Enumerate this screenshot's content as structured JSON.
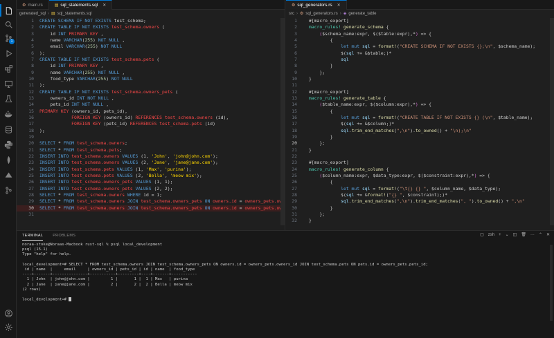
{
  "left_editor": {
    "tabs": [
      {
        "label": "main.rs",
        "active": false
      },
      {
        "label": "sql_statements.sql",
        "active": true
      }
    ],
    "breadcrumb": [
      "generated_sql",
      "sql_statements.sql"
    ],
    "lines": [
      [
        [
          "k",
          "CREATE SCHEMA IF NOT EXISTS "
        ],
        [
          "c",
          "test_schema;"
        ]
      ],
      [
        [
          "k",
          "CREATE TABLE IF NOT EXISTS "
        ],
        [
          "tbl",
          "test_schema.owners"
        ],
        [
          "c",
          " ("
        ]
      ],
      [
        [
          "c",
          "    id "
        ],
        [
          "k",
          "INT "
        ],
        [
          "tbl",
          "PRIMARY KEY"
        ],
        [
          "c",
          " ,"
        ]
      ],
      [
        [
          "c",
          "    name "
        ],
        [
          "k",
          "VARCHAR"
        ],
        [
          "c",
          "("
        ],
        [
          "n",
          "255"
        ],
        [
          "c",
          ") "
        ],
        [
          "k",
          "NOT NULL"
        ],
        [
          "c",
          " ,"
        ]
      ],
      [
        [
          "c",
          "    email "
        ],
        [
          "k",
          "VARCHAR"
        ],
        [
          "c",
          "("
        ],
        [
          "n",
          "255"
        ],
        [
          "c",
          ") "
        ],
        [
          "k",
          "NOT NULL"
        ]
      ],
      [
        [
          "c",
          ");"
        ]
      ],
      [
        [
          "k",
          "CREATE TABLE IF NOT EXISTS "
        ],
        [
          "tbl",
          "test_schema.pets"
        ],
        [
          "c",
          " ("
        ]
      ],
      [
        [
          "c",
          "    id "
        ],
        [
          "k",
          "INT "
        ],
        [
          "tbl",
          "PRIMARY KEY"
        ],
        [
          "c",
          " ,"
        ]
      ],
      [
        [
          "c",
          "    name "
        ],
        [
          "k",
          "VARCHAR"
        ],
        [
          "c",
          "("
        ],
        [
          "n",
          "255"
        ],
        [
          "c",
          ") "
        ],
        [
          "k",
          "NOT NULL"
        ],
        [
          "c",
          " ,"
        ]
      ],
      [
        [
          "c",
          "    food_type "
        ],
        [
          "k",
          "VARCHAR"
        ],
        [
          "c",
          "("
        ],
        [
          "n",
          "255"
        ],
        [
          "c",
          ") "
        ],
        [
          "k",
          "NOT NULL"
        ]
      ],
      [
        [
          "c",
          ");"
        ]
      ],
      [
        [
          "k",
          "CREATE TABLE IF NOT EXISTS "
        ],
        [
          "tbl",
          "test_schema.owners_pets"
        ],
        [
          "c",
          " ("
        ]
      ],
      [
        [
          "c",
          "    owners_id "
        ],
        [
          "k",
          "INT NOT NULL"
        ],
        [
          "c",
          " ,"
        ]
      ],
      [
        [
          "c",
          "    pets_id "
        ],
        [
          "k",
          "INT NOT NULL"
        ],
        [
          "c",
          " ,"
        ]
      ],
      [
        [
          "tbl",
          "PRIMARY KEY"
        ],
        [
          "c",
          " (owners_id, pets_id),"
        ]
      ],
      [
        [
          "c",
          "            "
        ],
        [
          "tbl",
          "FOREIGN KEY"
        ],
        [
          "c",
          " (owners_id) "
        ],
        [
          "tbl",
          "REFERENCES test_schema.owners"
        ],
        [
          "c",
          " (id),"
        ]
      ],
      [
        [
          "c",
          "            "
        ],
        [
          "tbl",
          "FOREIGN KEY"
        ],
        [
          "c",
          " (pets_id) "
        ],
        [
          "tbl",
          "REFERENCES test_schema.pets"
        ],
        [
          "c",
          " (id)"
        ]
      ],
      [
        [
          "c",
          ");"
        ]
      ],
      [
        [
          "c",
          ""
        ]
      ],
      [
        [
          "k",
          "SELECT "
        ],
        [
          "star",
          "* "
        ],
        [
          "k",
          "FROM "
        ],
        [
          "tbl",
          "test_schema.owners"
        ],
        [
          "c",
          ";"
        ]
      ],
      [
        [
          "k",
          "SELECT "
        ],
        [
          "star",
          "* "
        ],
        [
          "k",
          "FROM "
        ],
        [
          "tbl",
          "test_schema.pets"
        ],
        [
          "c",
          ";"
        ]
      ],
      [
        [
          "k",
          "INSERT INTO "
        ],
        [
          "tbl",
          "test_schema.owners"
        ],
        [
          "k",
          " VALUES "
        ],
        [
          "c",
          "(1, "
        ],
        [
          "y",
          "'John'"
        ],
        [
          "c",
          ", "
        ],
        [
          "y",
          "'john@john.com'"
        ],
        [
          "c",
          ");"
        ]
      ],
      [
        [
          "k",
          "INSERT INTO "
        ],
        [
          "tbl",
          "test_schema.owners"
        ],
        [
          "k",
          " VALUES "
        ],
        [
          "c",
          "(2, "
        ],
        [
          "y",
          "'Jane'"
        ],
        [
          "c",
          ", "
        ],
        [
          "y",
          "'jane@jane.com'"
        ],
        [
          "c",
          ");"
        ]
      ],
      [
        [
          "k",
          "INSERT INTO "
        ],
        [
          "tbl",
          "test_schema.pets"
        ],
        [
          "k",
          " VALUES "
        ],
        [
          "c",
          "(1, "
        ],
        [
          "y",
          "'Max'"
        ],
        [
          "c",
          ", "
        ],
        [
          "y",
          "'purina'"
        ],
        [
          "c",
          ");"
        ]
      ],
      [
        [
          "k",
          "INSERT INTO "
        ],
        [
          "tbl",
          "test_schema.pets"
        ],
        [
          "k",
          " VALUES "
        ],
        [
          "c",
          "(2, "
        ],
        [
          "y",
          "'Bella'"
        ],
        [
          "c",
          ", "
        ],
        [
          "y",
          "'meow mix'"
        ],
        [
          "c",
          ");"
        ]
      ],
      [
        [
          "k",
          "INSERT INTO "
        ],
        [
          "tbl",
          "test_schema.owners_pets"
        ],
        [
          "k",
          " VALUES "
        ],
        [
          "c",
          "(1, 1);"
        ]
      ],
      [
        [
          "k",
          "INSERT INTO "
        ],
        [
          "tbl",
          "test_schema.owners_pets"
        ],
        [
          "k",
          " VALUES "
        ],
        [
          "c",
          "(2, 2);"
        ]
      ],
      [
        [
          "k",
          "SELECT "
        ],
        [
          "star",
          "* "
        ],
        [
          "k",
          "FROM "
        ],
        [
          "tbl",
          "test_schema.owners"
        ],
        [
          "k",
          " WHERE "
        ],
        [
          "c",
          "id = 1;"
        ]
      ],
      [
        [
          "k",
          "SELECT "
        ],
        [
          "star",
          "* "
        ],
        [
          "k",
          "FROM "
        ],
        [
          "tbl",
          "test_schema.owners"
        ],
        [
          "k",
          " JOIN "
        ],
        [
          "tbl",
          "test_schema.owners_pets"
        ],
        [
          "k",
          " ON "
        ],
        [
          "tbl",
          "owners.id"
        ],
        [
          "c",
          " = "
        ],
        [
          "tbl",
          "owners_pets.ow"
        ]
      ],
      [
        [
          "k",
          "SELECT "
        ],
        [
          "star",
          "* "
        ],
        [
          "k",
          "FROM "
        ],
        [
          "tbl",
          "test_schema.owners"
        ],
        [
          "k",
          " JOIN "
        ],
        [
          "tbl",
          "test_schema.owners_pets"
        ],
        [
          "k",
          " ON "
        ],
        [
          "tbl",
          "owners.id"
        ],
        [
          "c",
          " = "
        ],
        [
          "tbl",
          "owners_pets.ow"
        ]
      ],
      [
        [
          "c",
          ""
        ]
      ]
    ],
    "highlight_line": 30,
    "line_numbers": [
      "1",
      "2",
      "3",
      "4",
      "5",
      "6",
      "7",
      "8",
      "9",
      "10",
      "11",
      "12",
      "13",
      "14",
      "15",
      "16",
      "17",
      "18",
      "19",
      "20",
      "21",
      "22",
      "23",
      "24",
      "25",
      "26",
      "27",
      "28",
      "29",
      "30",
      "31"
    ]
  },
  "right_editor": {
    "tabs": [
      {
        "label": "sql_generators.rs",
        "active": true
      }
    ],
    "breadcrumb": [
      "src",
      "sql_generators.rs",
      "generate_table"
    ],
    "lines": [
      [
        [
          "c",
          "#[macro_export]"
        ]
      ],
      [
        [
          "mac",
          "macro_rules! "
        ],
        [
          "m",
          "generate_schema"
        ],
        [
          "c",
          " {"
        ]
      ],
      [
        [
          "c",
          "    "
        ],
        [
          "p",
          "("
        ],
        [
          "c",
          "$schema_name:expr, $("
        ],
        [
          "c",
          "$table:expr"
        ],
        [
          "c",
          "),*"
        ],
        [
          "p",
          ")"
        ],
        [
          "c",
          " => {"
        ]
      ],
      [
        [
          "c",
          "        {"
        ]
      ],
      [
        [
          "c",
          "            "
        ],
        [
          "k",
          "let mut "
        ],
        [
          "v",
          "sql"
        ],
        [
          "c",
          " = "
        ],
        [
          "m",
          "format!"
        ],
        [
          "c",
          "("
        ],
        [
          "s",
          "\"CREATE SCHEMA IF NOT EXISTS {};\\n\""
        ],
        [
          "c",
          ", $schema_name);"
        ]
      ],
      [
        [
          "c",
          "            $("
        ],
        [
          "v",
          "sql"
        ],
        [
          "c",
          " += &$table;)*"
        ]
      ],
      [
        [
          "c",
          "            "
        ],
        [
          "v",
          "sql"
        ]
      ],
      [
        [
          "c",
          "        }"
        ]
      ],
      [
        [
          "c",
          "    };"
        ]
      ],
      [
        [
          "c",
          "}"
        ]
      ],
      [
        [
          "c",
          ""
        ]
      ],
      [
        [
          "c",
          "#[macro_export]"
        ]
      ],
      [
        [
          "mac",
          "macro_rules! "
        ],
        [
          "m",
          "generate_table"
        ],
        [
          "c",
          " {"
        ]
      ],
      [
        [
          "c",
          "    "
        ],
        [
          "p",
          "("
        ],
        [
          "c",
          "$table_name:expr, $("
        ],
        [
          "c",
          "$column:expr"
        ],
        [
          "c",
          "),*"
        ],
        [
          "p",
          ")"
        ],
        [
          "c",
          " => {"
        ]
      ],
      [
        [
          "c",
          "        {"
        ]
      ],
      [
        [
          "c",
          "            "
        ],
        [
          "k",
          "let mut "
        ],
        [
          "v",
          "sql"
        ],
        [
          "c",
          " = "
        ],
        [
          "m",
          "format!"
        ],
        [
          "c",
          "("
        ],
        [
          "s",
          "\"CREATE TABLE IF NOT EXISTS {} (\\n\""
        ],
        [
          "c",
          ", $table_name);"
        ]
      ],
      [
        [
          "c",
          "            $("
        ],
        [
          "v",
          "sql"
        ],
        [
          "c",
          " += &$column;)*"
        ]
      ],
      [
        [
          "c",
          "            "
        ],
        [
          "v",
          "sql"
        ],
        [
          "c",
          "."
        ],
        [
          "m",
          "trim_end_matches"
        ],
        [
          "c",
          "("
        ],
        [
          "s",
          "\",\\n\""
        ],
        [
          "c",
          ")."
        ],
        [
          "m",
          "to_owned"
        ],
        [
          "c",
          "() + "
        ],
        [
          "s",
          "\"\\n);\\n\""
        ]
      ],
      [
        [
          "c",
          "        }"
        ]
      ],
      [
        [
          "c",
          "    };"
        ]
      ],
      [
        [
          "c",
          "}"
        ]
      ],
      [
        [
          "c",
          ""
        ]
      ],
      [
        [
          "c",
          "#[macro_export]"
        ]
      ],
      [
        [
          "mac",
          "macro_rules! "
        ],
        [
          "m",
          "generate_column"
        ],
        [
          "c",
          " {"
        ]
      ],
      [
        [
          "c",
          "    "
        ],
        [
          "p",
          "("
        ],
        [
          "c",
          "$column_name:expr, $data_type:expr, $("
        ],
        [
          "c",
          "$constraint:expr"
        ],
        [
          "c",
          "),*"
        ],
        [
          "p",
          ")"
        ],
        [
          "c",
          " => {"
        ]
      ],
      [
        [
          "c",
          "        {"
        ]
      ],
      [
        [
          "c",
          "            "
        ],
        [
          "k",
          "let mut "
        ],
        [
          "v",
          "sql"
        ],
        [
          "c",
          " = "
        ],
        [
          "m",
          "format!"
        ],
        [
          "c",
          "("
        ],
        [
          "s",
          "\"\\t{} {} \""
        ],
        [
          "c",
          ", $column_name, $data_type);"
        ]
      ],
      [
        [
          "c",
          "            $("
        ],
        [
          "v",
          "sql"
        ],
        [
          "c",
          " += &"
        ],
        [
          "m",
          "format!"
        ],
        [
          "c",
          "("
        ],
        [
          "s",
          "\"{} \""
        ],
        [
          "c",
          ", $constraint);)*"
        ]
      ],
      [
        [
          "c",
          "            "
        ],
        [
          "v",
          "sql"
        ],
        [
          "c",
          "."
        ],
        [
          "m",
          "trim_end_matches"
        ],
        [
          "c",
          "("
        ],
        [
          "s",
          "\",\\n\""
        ],
        [
          "c",
          ")."
        ],
        [
          "m",
          "trim_end_matches"
        ],
        [
          "c",
          "("
        ],
        [
          "s",
          "\", \""
        ],
        [
          "c",
          ")."
        ],
        [
          "m",
          "to_owned"
        ],
        [
          "c",
          "() + "
        ],
        [
          "s",
          "\",\\n\""
        ]
      ],
      [
        [
          "c",
          "        }"
        ]
      ],
      [
        [
          "c",
          "    };"
        ]
      ],
      [
        [
          "c",
          "}"
        ]
      ]
    ],
    "current_line": 20,
    "line_numbers": [
      "1",
      "2",
      "3",
      "4",
      "5",
      "6",
      "7",
      "8",
      "9",
      "10",
      "11",
      "12",
      "13",
      "14",
      "15",
      "16",
      "17",
      "18",
      "19",
      "20",
      "21",
      "22",
      "23",
      "24",
      "25",
      "26",
      "27",
      "28",
      "29",
      "30",
      "31",
      "32"
    ]
  },
  "panel": {
    "tabs": [
      "TERMINAL",
      "PROBLEMS"
    ],
    "active_tab": "TERMINAL",
    "shell_label": "zsh",
    "terminal_lines": [
      "noraa-stoke@Noraas-Macbook rust-sql % psql local_development",
      "psql (15.1)",
      "Type \"help\" for help.",
      "",
      "local_development=# SELECT * FROM test_schema.owners JOIN test_schema.owners_pets ON owners.id = owners_pets.owners_id JOIN test_schema.pets ON pets.id = owners_pets.pets_id;",
      " id | name  |     email     | owners_id | pets_id | id | name  | food_type",
      "----+-------+---------------+-----------+---------+----+-------+-----------",
      "  1 | John  | john@john.com |         1 |       1 |  1 | Max   | purina",
      "  2 | Jane  | jane@jane.com |         2 |       2 |  2 | Bella | meow mix",
      "(2 rows)",
      "",
      "local_development=# "
    ]
  },
  "activity_bar": {
    "icons": [
      "files-icon",
      "search-icon",
      "source-control-icon",
      "run-debug-icon",
      "extensions-icon",
      "remote-explorer-icon",
      "testing-icon",
      "docker-icon",
      "database-icon",
      "python-icon",
      "leaf-icon",
      "deploy-icon",
      "git-graph-icon",
      "account-icon",
      "settings-icon"
    ],
    "source_control_badge": "1"
  }
}
